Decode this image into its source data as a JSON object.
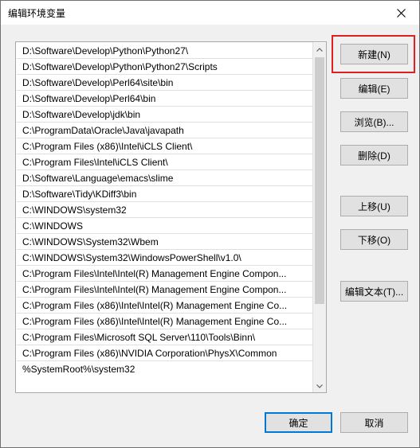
{
  "window": {
    "title": "编辑环境变量"
  },
  "list": {
    "items": [
      "D:\\Software\\Develop\\Python\\Python27\\",
      "D:\\Software\\Develop\\Python\\Python27\\Scripts",
      "D:\\Software\\Develop\\Perl64\\site\\bin",
      "D:\\Software\\Develop\\Perl64\\bin",
      "D:\\Software\\Develop\\jdk\\bin",
      "C:\\ProgramData\\Oracle\\Java\\javapath",
      "C:\\Program Files (x86)\\Intel\\iCLS Client\\",
      "C:\\Program Files\\Intel\\iCLS Client\\",
      "D:\\Software\\Language\\emacs\\slime",
      "D:\\Software\\Tidy\\KDiff3\\bin",
      "C:\\WINDOWS\\system32",
      "C:\\WINDOWS",
      "C:\\WINDOWS\\System32\\Wbem",
      "C:\\WINDOWS\\System32\\WindowsPowerShell\\v1.0\\",
      "C:\\Program Files\\Intel\\Intel(R) Management Engine Compon...",
      "C:\\Program Files\\Intel\\Intel(R) Management Engine Compon...",
      "C:\\Program Files (x86)\\Intel\\Intel(R) Management Engine Co...",
      "C:\\Program Files (x86)\\Intel\\Intel(R) Management Engine Co...",
      "C:\\Program Files\\Microsoft SQL Server\\110\\Tools\\Binn\\",
      "C:\\Program Files (x86)\\NVIDIA Corporation\\PhysX\\Common",
      "%SystemRoot%\\system32"
    ]
  },
  "buttons": {
    "new": "新建(N)",
    "edit": "编辑(E)",
    "browse": "浏览(B)...",
    "delete": "删除(D)",
    "move_up": "上移(U)",
    "move_down": "下移(O)",
    "edit_text": "编辑文本(T)...",
    "ok": "确定",
    "cancel": "取消"
  },
  "colors": {
    "highlight": "#e02020",
    "default_button_border": "#0078d7"
  },
  "icons": {
    "close": "close-icon",
    "scroll_up": "chevron-up-icon",
    "scroll_down": "chevron-down-icon"
  }
}
